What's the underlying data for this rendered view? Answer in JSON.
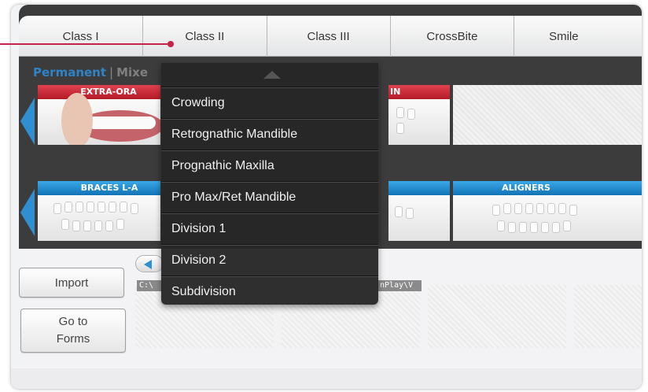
{
  "tabs": [
    {
      "label": "Class I"
    },
    {
      "label": "Class II"
    },
    {
      "label": "Class III"
    },
    {
      "label": "CrossBite"
    },
    {
      "label": "Smile"
    }
  ],
  "dentition": {
    "permanent_label": "Permanent",
    "mixed_label": "Mixe"
  },
  "gallery": {
    "row1": [
      {
        "label": "EXTRA-ORA"
      },
      {
        "label": "IN"
      },
      {
        "label": ""
      }
    ],
    "row2": [
      {
        "label": "BRACES L-A"
      },
      {
        "label": ""
      },
      {
        "label": "ALIGNERS"
      }
    ]
  },
  "dropdown": {
    "items": [
      {
        "label": "Crowding"
      },
      {
        "label": "Retrognathic Mandible"
      },
      {
        "label": "Prognathic Maxilla"
      },
      {
        "label": "Pro Max/Ret Mandible"
      },
      {
        "label": "Division 1"
      },
      {
        "label": "Division 2"
      },
      {
        "label": "Subdivision"
      }
    ]
  },
  "lower": {
    "import_label": "Import",
    "goto_label_line1": "Go to",
    "goto_label_line2": "Forms",
    "paths": [
      {
        "text": "C:\\"
      },
      {
        "text": "nPlay\\V"
      }
    ]
  },
  "colors": {
    "accent_blue": "#2f83c7",
    "header_red": "#c0202e",
    "header_blue": "#1a86c8",
    "callout": "#c7234a",
    "dropdown_bg": "#262626"
  }
}
